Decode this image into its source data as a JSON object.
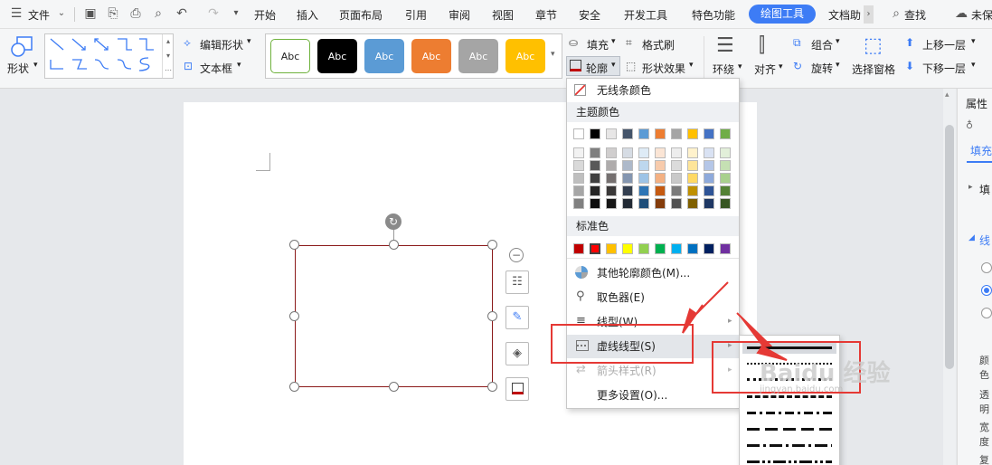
{
  "menubar": {
    "file_label": "文件",
    "tabs": [
      "开始",
      "插入",
      "页面布局",
      "引用",
      "审阅",
      "视图",
      "章节",
      "安全",
      "开发工具",
      "特色功能"
    ],
    "active_tab": "绘图工具",
    "doc_help": "文档助",
    "search": "查找",
    "unsaved": "未保"
  },
  "ribbon": {
    "shape": "形状",
    "edit_shape": "编辑形状",
    "textbox": "文本框",
    "style_samples": [
      {
        "text": "Abc",
        "bg": "#ffffff",
        "fg": "#222222",
        "border": "#6fb23e"
      },
      {
        "text": "Abc",
        "bg": "#000000",
        "fg": "#ffffff",
        "border": "#000000"
      },
      {
        "text": "Abc",
        "bg": "#5b9bd5",
        "fg": "#ffffff",
        "border": "#5b9bd5"
      },
      {
        "text": "Abc",
        "bg": "#ed7d31",
        "fg": "#ffffff",
        "border": "#ed7d31"
      },
      {
        "text": "Abc",
        "bg": "#a5a5a5",
        "fg": "#ffffff",
        "border": "#a5a5a5"
      },
      {
        "text": "Abc",
        "bg": "#ffc000",
        "fg": "#ffffff",
        "border": "#ffc000"
      }
    ],
    "fill": "填充",
    "format_brush": "格式刷",
    "outline": "轮廓",
    "shape_effects": "形状效果",
    "wrap": "环绕",
    "align": "对齐",
    "group": "组合",
    "rotate": "旋转",
    "select_pane": "选择窗格",
    "bring_forward": "上移一层",
    "send_backward": "下移一层"
  },
  "outline_menu": {
    "no_line": "无线条颜色",
    "theme_colors": "主题颜色",
    "standard_colors": "标准色",
    "more_colors": "其他轮廓颜色(M)...",
    "eyedropper": "取色器(E)",
    "line_type": "线型(W)",
    "dash_type": "虚线线型(S)",
    "arrow_style": "箭头样式(R)",
    "more_settings": "更多设置(O)..."
  },
  "theme_top": [
    "#ffffff",
    "#000000",
    "#e7e6e6",
    "#44546a",
    "#5b9bd5",
    "#ed7d31",
    "#a5a5a5",
    "#ffc000",
    "#4472c4",
    "#70ad47"
  ],
  "theme_shades": [
    [
      "#f2f2f2",
      "#d9d9d9",
      "#bfbfbf",
      "#a6a6a6",
      "#808080"
    ],
    [
      "#7f7f7f",
      "#595959",
      "#404040",
      "#262626",
      "#0d0d0d"
    ],
    [
      "#d0cece",
      "#aeabab",
      "#757070",
      "#3a3838",
      "#161616"
    ],
    [
      "#d6dce4",
      "#adb9ca",
      "#8496b0",
      "#333f50",
      "#222a35"
    ],
    [
      "#deebf6",
      "#bdd7ee",
      "#9dc3e6",
      "#2e75b5",
      "#1f4e79"
    ],
    [
      "#fbe5d5",
      "#f7cbac",
      "#f4b183",
      "#c55a11",
      "#843c0b"
    ],
    [
      "#ededed",
      "#dbdbdb",
      "#c9c9c9",
      "#7b7b7b",
      "#525252"
    ],
    [
      "#fff2cc",
      "#fee599",
      "#ffd965",
      "#bf9000",
      "#7f6000"
    ],
    [
      "#d9e2f3",
      "#b4c6e7",
      "#8eaadb",
      "#2f5496",
      "#1f3864"
    ],
    [
      "#e2efd9",
      "#c5e0b3",
      "#a8d08d",
      "#538135",
      "#375623"
    ]
  ],
  "standard": [
    "#c00000",
    "#ff0000",
    "#ffc000",
    "#ffff00",
    "#92d050",
    "#00b050",
    "#00b0f0",
    "#0070c0",
    "#002060",
    "#7030a0"
  ],
  "right_panel": {
    "title": "属性",
    "tab": "填充",
    "fill_section": "填",
    "line_section": "线",
    "color": "颜色",
    "transparency": "透明",
    "width": "宽度",
    "compound": "复合"
  },
  "watermark": "Baidu 经验",
  "watermark_url": "jingyan.baidu.com"
}
